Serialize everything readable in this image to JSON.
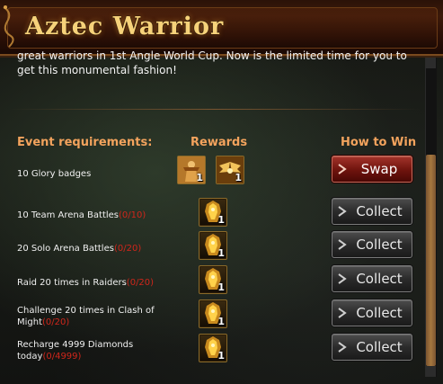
{
  "header": {
    "title": "Aztec Warrior"
  },
  "description": "great warriors in 1st Angle World Cup. Now is the limited time for you to get this monumental fashion!",
  "columns": {
    "requirements": "Event requirements:",
    "rewards": "Rewards",
    "how_to_win": "How to Win"
  },
  "rows": [
    {
      "requirement": "10 Glory badges",
      "progress": "",
      "rewards": [
        {
          "icon": "warrior-figure-icon",
          "qty": "1"
        },
        {
          "icon": "golden-wings-icon",
          "qty": "1"
        }
      ],
      "action": "Swap"
    },
    {
      "requirement": "10 Team Arena Battles",
      "progress": "0/10",
      "rewards": [
        {
          "icon": "golden-armor-icon",
          "qty": "1"
        }
      ],
      "action": "Collect"
    },
    {
      "requirement": "20 Solo Arena Battles",
      "progress": "0/20",
      "rewards": [
        {
          "icon": "golden-armor-icon",
          "qty": "1"
        }
      ],
      "action": "Collect"
    },
    {
      "requirement": "Raid 20 times in Raiders",
      "progress": "0/20",
      "rewards": [
        {
          "icon": "golden-armor-icon",
          "qty": "1"
        }
      ],
      "action": "Collect"
    },
    {
      "requirement": "Challenge 20 times in Clash of Might",
      "progress": "0/20",
      "rewards": [
        {
          "icon": "golden-armor-icon",
          "qty": "1"
        }
      ],
      "action": "Collect"
    },
    {
      "requirement": "Recharge 4999 Diamonds today",
      "progress": "0/4999",
      "rewards": [
        {
          "icon": "golden-armor-icon",
          "qty": "1"
        }
      ],
      "action": "Collect"
    }
  ],
  "colors": {
    "title": "#f6d27a",
    "header_column": "#f3a35d",
    "progress": "#d0261b",
    "swap_button": "#8a1f17",
    "collect_button": "#333333"
  }
}
